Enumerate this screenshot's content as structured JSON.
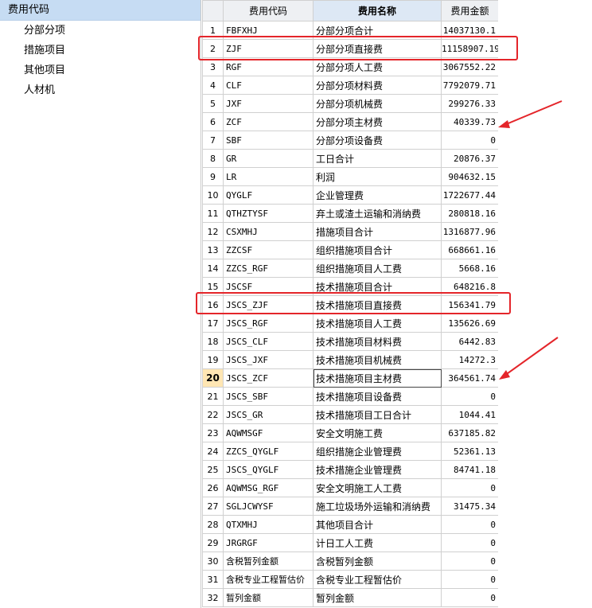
{
  "sidebar": {
    "title": "费用代码",
    "items": [
      "分部分项",
      "措施项目",
      "其他项目",
      "人材机"
    ]
  },
  "table": {
    "headers": {
      "code": "费用代码",
      "name": "费用名称",
      "amount": "费用金额"
    },
    "selected_row": 20,
    "rows": [
      {
        "n": "1",
        "code": "FBFXHJ",
        "name": "分部分项合计",
        "amount": "14037130.1"
      },
      {
        "n": "2",
        "code": "ZJF",
        "name": "分部分项直接费",
        "amount": "11158907.19"
      },
      {
        "n": "3",
        "code": "RGF",
        "name": "分部分项人工费",
        "amount": "3067552.22"
      },
      {
        "n": "4",
        "code": "CLF",
        "name": "分部分项材料费",
        "amount": "7792079.71"
      },
      {
        "n": "5",
        "code": "JXF",
        "name": "分部分项机械费",
        "amount": "299276.33"
      },
      {
        "n": "6",
        "code": "ZCF",
        "name": "分部分项主材费",
        "amount": "40339.73"
      },
      {
        "n": "7",
        "code": "SBF",
        "name": "分部分项设备费",
        "amount": "0"
      },
      {
        "n": "8",
        "code": "GR",
        "name": "工日合计",
        "amount": "20876.37"
      },
      {
        "n": "9",
        "code": "LR",
        "name": "利润",
        "amount": "904632.15"
      },
      {
        "n": "10",
        "code": "QYGLF",
        "name": "企业管理费",
        "amount": "1722677.44"
      },
      {
        "n": "11",
        "code": "QTHZTYSF",
        "name": "弃土或渣土运输和消纳费",
        "amount": "280818.16"
      },
      {
        "n": "12",
        "code": "CSXMHJ",
        "name": "措施项目合计",
        "amount": "1316877.96"
      },
      {
        "n": "13",
        "code": "ZZCSF",
        "name": "组织措施项目合计",
        "amount": "668661.16"
      },
      {
        "n": "14",
        "code": "ZZCS_RGF",
        "name": "组织措施项目人工费",
        "amount": "5668.16"
      },
      {
        "n": "15",
        "code": "JSCSF",
        "name": "技术措施项目合计",
        "amount": "648216.8"
      },
      {
        "n": "16",
        "code": "JSCS_ZJF",
        "name": "技术措施项目直接费",
        "amount": "156341.79"
      },
      {
        "n": "17",
        "code": "JSCS_RGF",
        "name": "技术措施项目人工费",
        "amount": "135626.69"
      },
      {
        "n": "18",
        "code": "JSCS_CLF",
        "name": "技术措施项目材料费",
        "amount": "6442.83"
      },
      {
        "n": "19",
        "code": "JSCS_JXF",
        "name": "技术措施项目机械费",
        "amount": "14272.3"
      },
      {
        "n": "20",
        "code": "JSCS_ZCF",
        "name": "技术措施项目主材费",
        "amount": "364561.74"
      },
      {
        "n": "21",
        "code": "JSCS_SBF",
        "name": "技术措施项目设备费",
        "amount": "0"
      },
      {
        "n": "22",
        "code": "JSCS_GR",
        "name": "技术措施项目工日合计",
        "amount": "1044.41"
      },
      {
        "n": "23",
        "code": "AQWMSGF",
        "name": "安全文明施工费",
        "amount": "637185.82"
      },
      {
        "n": "24",
        "code": "ZZCS_QYGLF",
        "name": "组织措施企业管理费",
        "amount": "52361.13"
      },
      {
        "n": "25",
        "code": "JSCS_QYGLF",
        "name": "技术措施企业管理费",
        "amount": "84741.18"
      },
      {
        "n": "26",
        "code": "AQWMSG_RGF",
        "name": "安全文明施工人工费",
        "amount": "0"
      },
      {
        "n": "27",
        "code": "SGLJCWYSF",
        "name": "施工垃圾场外运输和消纳费",
        "amount": "31475.34"
      },
      {
        "n": "28",
        "code": "QTXMHJ",
        "name": "其他项目合计",
        "amount": "0"
      },
      {
        "n": "29",
        "code": "JRGRGF",
        "name": "计日工人工费",
        "amount": "0"
      },
      {
        "n": "30",
        "code": "含税暂列金额",
        "name": "含税暂列金额",
        "amount": "0"
      },
      {
        "n": "31",
        "code": "含税专业工程暂估价",
        "name": "含税专业工程暂估价",
        "amount": "0"
      },
      {
        "n": "32",
        "code": "暂列金额",
        "name": "暂列金额",
        "amount": "0"
      }
    ]
  },
  "annotation_color": "#e4252a"
}
